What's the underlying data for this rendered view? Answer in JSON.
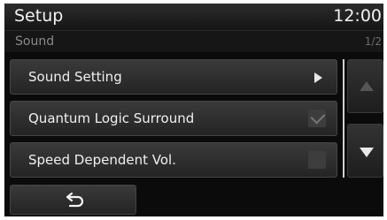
{
  "header": {
    "title": "Setup",
    "clock": "12:00"
  },
  "subheader": {
    "section": "Sound",
    "page_indicator": "1/2"
  },
  "menu": {
    "items": [
      {
        "label": "Sound Setting",
        "control": "arrow"
      },
      {
        "label": "Quantum Logic Surround",
        "control": "checkbox",
        "checked": true
      },
      {
        "label": "Speed Dependent Vol.",
        "control": "checkbox",
        "checked": false
      }
    ]
  },
  "scroll": {
    "up_enabled": false,
    "down_enabled": true
  },
  "icons": {
    "sound_setting_arrow": "play-arrow-icon",
    "scroll_up": "triangle-up-icon",
    "scroll_down": "triangle-down-icon",
    "back": "return-arrow-icon"
  },
  "colors": {
    "background": "#0b0b0b",
    "text": "#f0f0f0",
    "muted_text": "#8a8a8a"
  }
}
